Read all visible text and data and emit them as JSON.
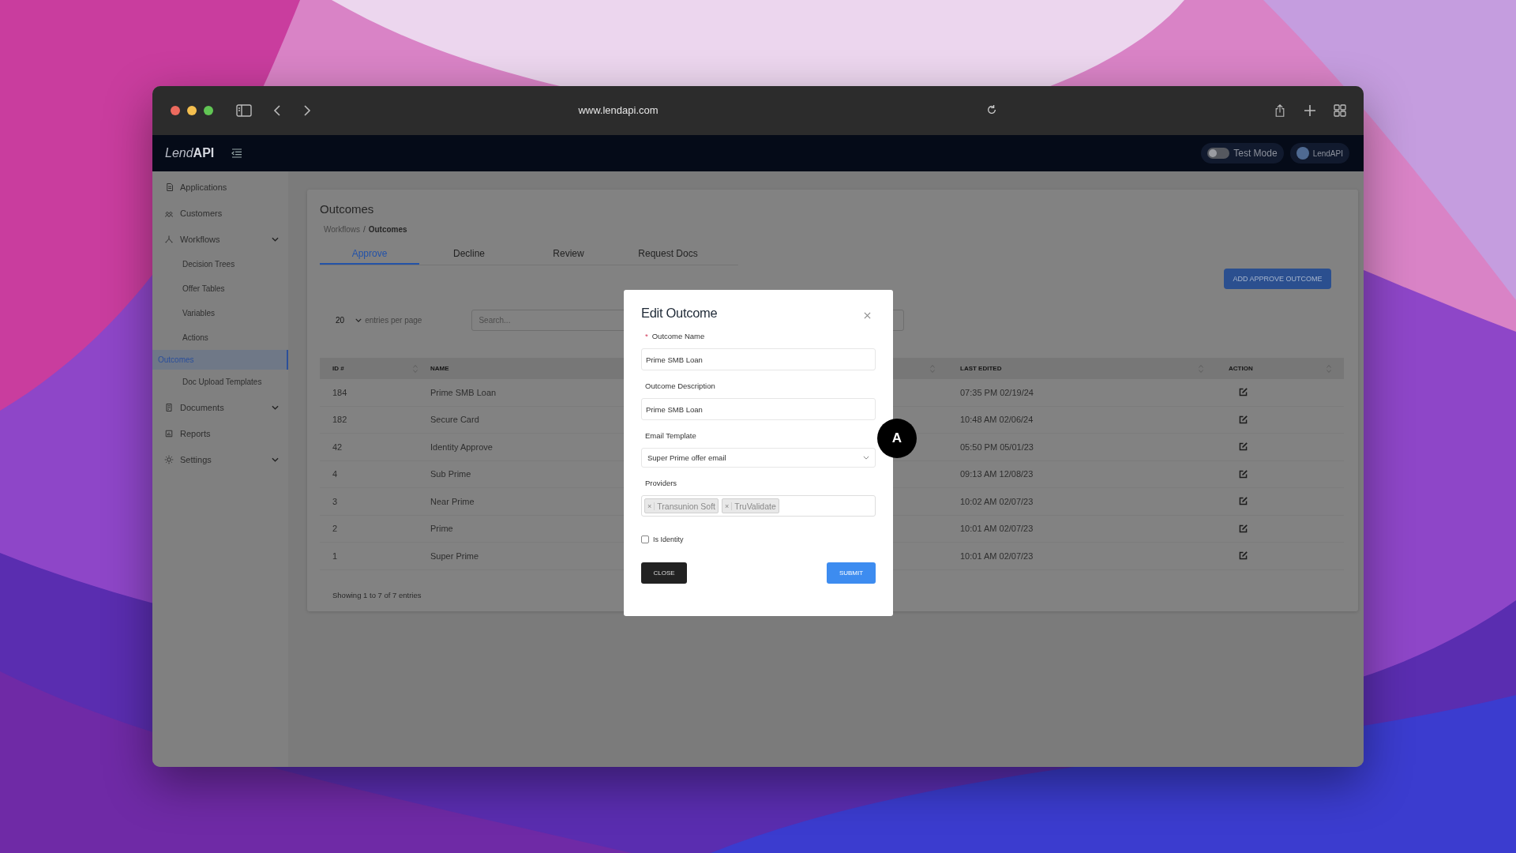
{
  "browser": {
    "url": "www.lendapi.com"
  },
  "app_header": {
    "logo_light": "Lend",
    "logo_bold": "API",
    "test_mode": {
      "label": "Test Mode",
      "on": false
    },
    "account": "LendAPI"
  },
  "sidebar": {
    "items": [
      {
        "label": "Applications",
        "selected": false,
        "chevron": false
      },
      {
        "label": "Customers",
        "selected": false,
        "chevron": false
      },
      {
        "label": "Workflows",
        "selected": false,
        "chevron": true,
        "children": [
          {
            "label": "Decision Trees",
            "selected": false
          },
          {
            "label": "Offer Tables",
            "selected": false
          },
          {
            "label": "Variables",
            "selected": false
          },
          {
            "label": "Actions",
            "selected": false
          },
          {
            "label": "Outcomes",
            "selected": true
          },
          {
            "label": "Doc Upload Templates",
            "selected": false
          }
        ]
      },
      {
        "label": "Documents",
        "selected": false,
        "chevron": true
      },
      {
        "label": "Reports",
        "selected": false,
        "chevron": false
      },
      {
        "label": "Settings",
        "selected": false,
        "chevron": true
      }
    ]
  },
  "page": {
    "title": "Outcomes",
    "breadcrumb": {
      "items": [
        "Workflows",
        "Outcomes"
      ],
      "separator": "/"
    },
    "tabs": [
      {
        "label": "Approve",
        "selected": true
      },
      {
        "label": "Decline",
        "selected": false
      },
      {
        "label": "Review",
        "selected": false
      },
      {
        "label": "Request Docs",
        "selected": false
      }
    ],
    "add_button": "ADD APPROVE OUTCOME",
    "entries": {
      "value": "20",
      "label": "entries per page"
    },
    "search": {
      "placeholder": "Search..."
    },
    "table": {
      "columns": [
        {
          "label": "ID #",
          "sortable": true
        },
        {
          "label": "NAME",
          "sortable": false
        },
        {
          "sortable": true
        },
        {
          "label": "LAST EDITED",
          "sortable": true
        },
        {
          "label": "ACTION",
          "sortable": true
        }
      ],
      "rows": [
        {
          "id": "184",
          "name": "Prime SMB Loan",
          "last_edited": "07:35 PM 02/19/24"
        },
        {
          "id": "182",
          "name": "Secure Card",
          "last_edited": "10:48 AM 02/06/24"
        },
        {
          "id": "42",
          "name": "Identity Approve",
          "last_edited": "05:50 PM 05/01/23"
        },
        {
          "id": "4",
          "name": "Sub Prime",
          "last_edited": "09:13 AM 12/08/23"
        },
        {
          "id": "3",
          "name": "Near Prime",
          "last_edited": "10:02 AM 02/07/23"
        },
        {
          "id": "2",
          "name": "Prime",
          "last_edited": "10:01 AM 02/07/23"
        },
        {
          "id": "1",
          "name": "Super Prime",
          "last_edited": "10:01 AM 02/07/23"
        }
      ]
    },
    "footer": "Showing 1 to 7 of 7 entries"
  },
  "modal": {
    "title": "Edit Outcome",
    "fields": [
      {
        "kind": "text",
        "required_mark": "*",
        "label": "Outcome Name",
        "value": "Prime SMB Loan"
      },
      {
        "kind": "text",
        "label": "Outcome Description",
        "value": "Prime SMB Loan"
      },
      {
        "kind": "select",
        "label": "Email Template",
        "value": "Super Prime offer email"
      },
      {
        "kind": "tags",
        "label": "Providers",
        "tags": [
          {
            "remove": "×",
            "label": "Transunion Soft"
          },
          {
            "remove": "×",
            "label": "TruValidate"
          }
        ]
      }
    ],
    "checkbox": {
      "label": "Is Identity",
      "checked": false
    },
    "buttons": {
      "close": "CLOSE",
      "submit": "SUBMIT"
    }
  },
  "annotation": {
    "marker": "A"
  }
}
